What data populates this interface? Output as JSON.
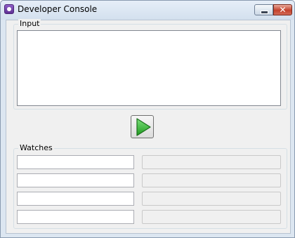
{
  "window": {
    "title": "Developer Console",
    "close_glyph": "✕"
  },
  "input": {
    "label": "Input",
    "value": ""
  },
  "run_button": {
    "icon": "play-icon",
    "color": "#2bb02b"
  },
  "watches": {
    "label": "Watches",
    "rows": [
      {
        "name": "",
        "value": ""
      },
      {
        "name": "",
        "value": ""
      },
      {
        "name": "",
        "value": ""
      },
      {
        "name": "",
        "value": ""
      }
    ]
  }
}
